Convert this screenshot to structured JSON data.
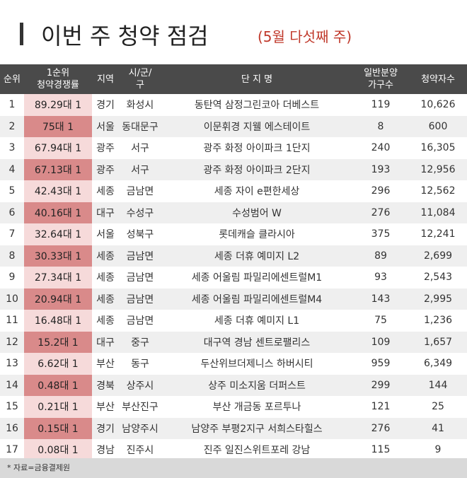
{
  "title": {
    "main": "이번 주 청약 점검",
    "sub": "(5월 다섯째 주)"
  },
  "table": {
    "headers": {
      "rank": "순위",
      "ratio": "1순위\n청약경쟁률",
      "region": "지역",
      "city": "시/군/\n구",
      "complex": "단 지 명",
      "units": "일반분양\n가구수",
      "applicants": "청약자수"
    },
    "rows": [
      {
        "rank": "1",
        "ratio": "89.29대 1",
        "region": "경기",
        "city": "화성시",
        "complex": "동탄역 삼정그린코아 더베스트",
        "units": "119",
        "applicants": "10,626"
      },
      {
        "rank": "2",
        "ratio": "75대 1",
        "region": "서울",
        "city": "동대문구",
        "complex": "이문휘경 지웰 에스테이트",
        "units": "8",
        "applicants": "600"
      },
      {
        "rank": "3",
        "ratio": "67.94대 1",
        "region": "광주",
        "city": "서구",
        "complex": "광주 화정 아이파크 1단지",
        "units": "240",
        "applicants": "16,305"
      },
      {
        "rank": "4",
        "ratio": "67.13대 1",
        "region": "광주",
        "city": "서구",
        "complex": "광주 화정 아이파크 2단지",
        "units": "193",
        "applicants": "12,956"
      },
      {
        "rank": "5",
        "ratio": "42.43대 1",
        "region": "세종",
        "city": "금남면",
        "complex": "세종 자이 e편한세상",
        "units": "296",
        "applicants": "12,562"
      },
      {
        "rank": "6",
        "ratio": "40.16대 1",
        "region": "대구",
        "city": "수성구",
        "complex": "수성범어 W",
        "units": "276",
        "applicants": "11,084"
      },
      {
        "rank": "7",
        "ratio": "32.64대 1",
        "region": "서울",
        "city": "성북구",
        "complex": "롯데캐슬 클라시아",
        "units": "375",
        "applicants": "12,241"
      },
      {
        "rank": "8",
        "ratio": "30.33대 1",
        "region": "세종",
        "city": "금남면",
        "complex": "세종 더휴 예미지 L2",
        "units": "89",
        "applicants": "2,699"
      },
      {
        "rank": "9",
        "ratio": "27.34대 1",
        "region": "세종",
        "city": "금남면",
        "complex": "세종 어울림 파밀리에센트럴M1",
        "units": "93",
        "applicants": "2,543"
      },
      {
        "rank": "10",
        "ratio": "20.94대 1",
        "region": "세종",
        "city": "금남면",
        "complex": "세종 어울림 파밀리에센트럴M4",
        "units": "143",
        "applicants": "2,995"
      },
      {
        "rank": "11",
        "ratio": "16.48대 1",
        "region": "세종",
        "city": "금남면",
        "complex": "세종 더휴 예미지 L1",
        "units": "75",
        "applicants": "1,236"
      },
      {
        "rank": "12",
        "ratio": "15.2대 1",
        "region": "대구",
        "city": "중구",
        "complex": "대구역 경남 센트로팰리스",
        "units": "109",
        "applicants": "1,657"
      },
      {
        "rank": "13",
        "ratio": "6.62대 1",
        "region": "부산",
        "city": "동구",
        "complex": "두산위브더제니스 하버시티",
        "units": "959",
        "applicants": "6,349"
      },
      {
        "rank": "14",
        "ratio": "0.48대 1",
        "region": "경북",
        "city": "상주시",
        "complex": "상주 미소지움 더퍼스트",
        "units": "299",
        "applicants": "144"
      },
      {
        "rank": "15",
        "ratio": "0.21대 1",
        "region": "부산",
        "city": "부산진구",
        "complex": "부산 개금동 포르투나",
        "units": "121",
        "applicants": "25"
      },
      {
        "rank": "16",
        "ratio": "0.15대 1",
        "region": "경기",
        "city": "남양주시",
        "complex": "남양주 부평2지구 서희스타힐스",
        "units": "276",
        "applicants": "41"
      },
      {
        "rank": "17",
        "ratio": "0.08대 1",
        "region": "경남",
        "city": "진주시",
        "complex": "진주 일진스위트포레 강남",
        "units": "115",
        "applicants": "9"
      }
    ]
  },
  "footer": {
    "source": "* 자료=금융결제원"
  },
  "colors": {
    "accent": "#c0392b",
    "header_bg": "#4a4a4a",
    "ratio_highlight": "#d98a8a",
    "ratio_light": "#f6dada"
  }
}
